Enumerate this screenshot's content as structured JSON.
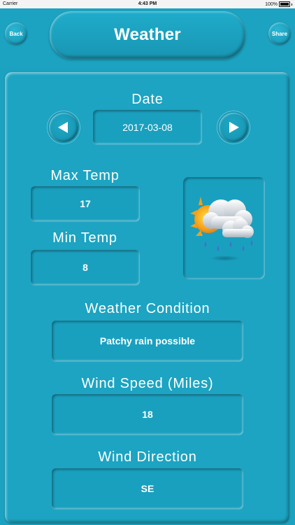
{
  "status_bar": {
    "carrier": "Carrier",
    "time": "4:43 PM",
    "battery": "100%"
  },
  "header": {
    "title": "Weather",
    "back_label": "Back",
    "share_label": "Share"
  },
  "weather": {
    "date_label": "Date",
    "date": "2017-03-08",
    "max_temp_label": "Max Temp",
    "max_temp": "17",
    "min_temp_label": "Min Temp",
    "min_temp": "8",
    "condition_label": "Weather Condition",
    "condition": "Patchy rain possible",
    "wind_speed_label": "Wind Speed (Miles)",
    "wind_speed": "18",
    "wind_direction_label": "Wind Direction",
    "wind_direction": "SE"
  },
  "icons": {
    "prev": "left-arrow-icon",
    "next": "right-arrow-icon",
    "weather": "cloud-sun-rain-icon"
  }
}
